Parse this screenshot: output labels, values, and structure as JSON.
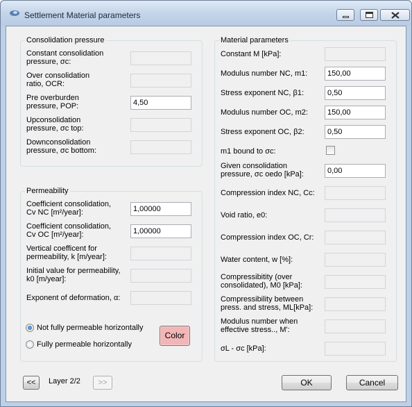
{
  "window": {
    "title": "Settlement Material parameters",
    "minimize_icon": "minimize-icon",
    "maximize_icon": "maximize-icon",
    "close_icon": "close-icon",
    "app_icon": "app-icon"
  },
  "consolidation": {
    "title": "Consolidation pressure",
    "rows": [
      {
        "label_1": "Constant consolidation",
        "label_2": "pressure, σc:",
        "value": "",
        "enabled": false
      },
      {
        "label_1": "Over consolidation",
        "label_2": "ratio, OCR:",
        "value": "",
        "enabled": false
      },
      {
        "label_1": "Pre overburden",
        "label_2": "pressure, POP:",
        "value": "4,50",
        "enabled": true
      },
      {
        "label_1": "Upconsolidation",
        "label_2": "pressure, σc top:",
        "value": "",
        "enabled": false
      },
      {
        "label_1": "Downconsolidation",
        "label_2": "pressure, σc bottom:",
        "value": "",
        "enabled": false
      }
    ]
  },
  "permeability": {
    "title": "Permeability",
    "rows": [
      {
        "label_1": "Coefficient consolidation,",
        "label_2": "Cv NC [m²/year]:",
        "value": "1,00000",
        "enabled": true
      },
      {
        "label_1": "Coefficient consolidation,",
        "label_2": "Cv OC [m²/year]:",
        "value": "1,00000",
        "enabled": true
      },
      {
        "label_1": "Vertical coefficent for",
        "label_2": "permeability, k  [m/year]:",
        "value": "",
        "enabled": false
      },
      {
        "label_1": "Initial value for permeability,",
        "label_2": "k0 [m/year]:",
        "value": "",
        "enabled": false
      },
      {
        "label_1": "Exponent of deformation, α:",
        "label_2": "",
        "value": "",
        "enabled": false
      }
    ],
    "radio_not_fully": "Not fully permeable horizontally",
    "radio_fully": "Fully permeable horizontally",
    "color_button": "Color",
    "color_button_bg": "#f2b6b6"
  },
  "material": {
    "title": "Material parameters",
    "rows": [
      {
        "label_1": "Constant M [kPa]:",
        "label_2": "",
        "value": "",
        "enabled": false
      },
      {
        "label_1": "Modulus number NC, m1:",
        "label_2": "",
        "value": "150,00",
        "enabled": true
      },
      {
        "label_1": "Stress exponent NC, β1:",
        "label_2": "",
        "value": "0,50",
        "enabled": true
      },
      {
        "label_1": "Modulus number OC, m2:",
        "label_2": "",
        "value": "150,00",
        "enabled": true
      },
      {
        "label_1": "Stress exponent OC, β2:",
        "label_2": "",
        "value": "0,50",
        "enabled": true
      },
      {
        "label_1": "m1 bound to σc:",
        "label_2": "",
        "value": "",
        "enabled": true
      },
      {
        "label_1": "Given consolidation",
        "label_2": "pressure, σc oedo [kPa]:",
        "value": "0,00",
        "enabled": true
      },
      {
        "label_1": "Compression index NC, Cc:",
        "label_2": "",
        "value": "",
        "enabled": false
      },
      {
        "label_1": "Void ratio, e0:",
        "label_2": "",
        "value": "",
        "enabled": false
      },
      {
        "label_1": "Compression index OC, Cr:",
        "label_2": "",
        "value": "",
        "enabled": false
      },
      {
        "label_1": "Water content, w  [%]:",
        "label_2": "",
        "value": "",
        "enabled": false
      },
      {
        "label_1": "Compressibitity (over",
        "label_2": "consolidated), M0 [kPa]:",
        "value": "",
        "enabled": false
      },
      {
        "label_1": "Compressibility between",
        "label_2": "press. and stress, ML[kPa]:",
        "value": "",
        "enabled": false
      },
      {
        "label_1": "Modulus number when",
        "label_2": "effective stress.., M':",
        "value": "",
        "enabled": false
      },
      {
        "label_1": "σL - σc [kPa]:",
        "label_2": "",
        "value": "",
        "enabled": false
      }
    ]
  },
  "footer": {
    "prev_button": "<<",
    "layer_label": "Layer 2/2",
    "next_button": ">>",
    "ok_button": "OK",
    "cancel_button": "Cancel"
  }
}
